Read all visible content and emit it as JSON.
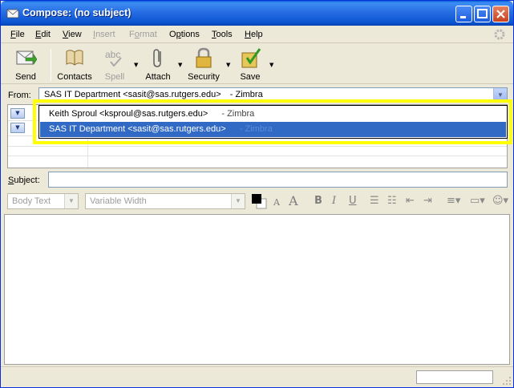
{
  "window": {
    "title": "Compose: (no subject)",
    "accent": "#0A54D1"
  },
  "menu": [
    {
      "label": "File",
      "underline": "F"
    },
    {
      "label": "Edit",
      "underline": "E"
    },
    {
      "label": "View",
      "underline": "V"
    },
    {
      "label": "Insert",
      "underline": "I",
      "disabled": true
    },
    {
      "label": "Format",
      "underline": "o",
      "disabled": true
    },
    {
      "label": "Options",
      "underline": "p"
    },
    {
      "label": "Tools",
      "underline": "T"
    },
    {
      "label": "Help",
      "underline": "H"
    }
  ],
  "toolbar": {
    "send": "Send",
    "contacts": "Contacts",
    "spell": "Spell",
    "spell_icon_text": "abc",
    "attach": "Attach",
    "security": "Security",
    "save": "Save"
  },
  "header": {
    "from_label": "From:",
    "from_value": "SAS IT Department <sasit@sas.rutgers.edu>",
    "from_suffix": "- Zimbra",
    "subject_label": "Subject:",
    "subject_value": ""
  },
  "autocomplete": [
    {
      "name": "Keith Sproul <ksproul@sas.rutgers.edu>",
      "account": "- Zimbra",
      "selected": false
    },
    {
      "name": "SAS IT Department <sasit@sas.rutgers.edu>",
      "account": "- Zimbra",
      "selected": true
    }
  ],
  "formatbar": {
    "paragraph_style": "Body Text",
    "font": "Variable Width",
    "bold": "B",
    "italic": "I",
    "underline": "U",
    "text_color": "#000000",
    "smaller_text": "A",
    "larger_text": "A"
  },
  "colors": {
    "highlight": "#FFFF00",
    "selection": "#316AC5",
    "chrome": "#ECE9D8"
  }
}
